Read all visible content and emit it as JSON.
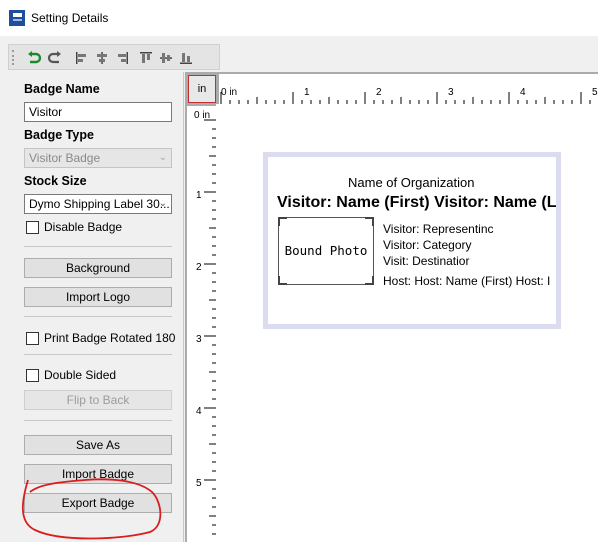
{
  "window": {
    "title": "Setting Details"
  },
  "toolbar": {
    "icons": [
      "undo-icon",
      "redo-icon",
      "align-left-icon",
      "align-center-icon",
      "align-right-icon",
      "align-top-icon",
      "align-middle-icon",
      "align-bottom-icon"
    ]
  },
  "panel": {
    "badge_name_label": "Badge Name",
    "badge_name_value": "Visitor",
    "badge_type_label": "Badge Type",
    "badge_type_value": "Visitor Badge",
    "stock_size_label": "Stock Size",
    "stock_size_value": "Dymo Shipping Label 30...",
    "disable_badge": "Disable Badge",
    "background": "Background",
    "import_logo": "Import Logo",
    "print_rotated": "Print Badge Rotated 180",
    "double_sided": "Double Sided",
    "flip_to_back": "Flip to Back",
    "save_as": "Save As",
    "import_badge": "Import Badge",
    "export_badge": "Export Badge"
  },
  "ruler": {
    "unit": "in",
    "h_labels": [
      "0 in",
      "1",
      "2",
      "3",
      "4",
      "5"
    ],
    "v_labels": [
      "0 in",
      "1",
      "2",
      "3",
      "4",
      "5"
    ]
  },
  "badge": {
    "org": "Name of Organization",
    "visitor_name": "Visitor: Name (First) Visitor: Name (L",
    "photo": "Bound Photo",
    "representing": "Visitor: Representinc",
    "category": "Visitor: Category",
    "destination": "Visit: Destinatior",
    "host": "Host:  Host: Name (First) Host: I"
  },
  "colors": {
    "annotation": "#d81e1e",
    "badge_border": "#dcdcf0"
  }
}
